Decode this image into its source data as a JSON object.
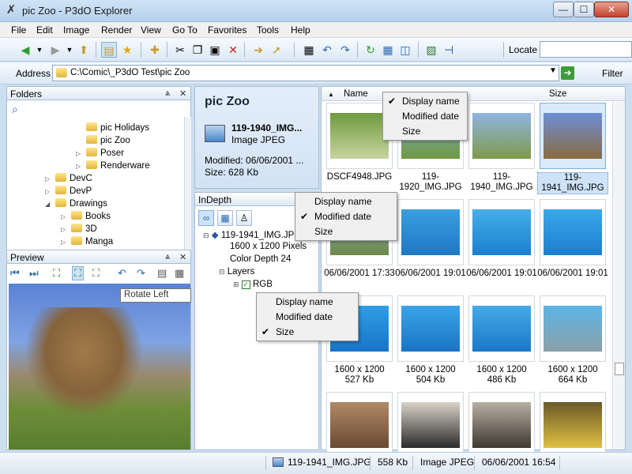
{
  "window": {
    "title": "pic Zoo - P3dO Explorer"
  },
  "menu": [
    "File",
    "Edit",
    "Image",
    "Render",
    "View",
    "Go To",
    "Favorites",
    "Tools",
    "Help"
  ],
  "toolbar": {
    "locate_label": "Locate",
    "locate_value": ""
  },
  "address": {
    "label": "Address",
    "path": "C:\\Comic\\_P3dO Test\\pic Zoo",
    "filter_label": "Filter"
  },
  "folders": {
    "title": "Folders",
    "items": [
      {
        "label": "pic Holidays"
      },
      {
        "label": "pic Zoo"
      },
      {
        "label": "Poser"
      },
      {
        "label": "Renderware"
      },
      {
        "label": "DevC"
      },
      {
        "label": "DevP"
      },
      {
        "label": "Drawings"
      },
      {
        "label": "Books"
      },
      {
        "label": "3D"
      },
      {
        "label": "Manga"
      }
    ]
  },
  "preview": {
    "title": "Preview",
    "tooltip": "Rotate Left"
  },
  "info": {
    "title": "pic Zoo",
    "name": "119-1940_IMG...",
    "type": "Image JPEG",
    "modified": "Modified: 06/06/2001 ...",
    "size": "Size: 628 Kb"
  },
  "indepth": {
    "title": "InDepth",
    "tree": [
      "119-1941_IMG.JPG",
      "1600 x 1200 Pixels",
      "Color Depth 24",
      "Layers",
      "RGB"
    ]
  },
  "filelist": {
    "columns": [
      "Name",
      "Size"
    ],
    "thumbs": [
      {
        "caption": "DSCF4948.JPG",
        "colors": [
          "#6e9a3e",
          "#c8d4a0"
        ]
      },
      {
        "caption": "119-1920_IMG.JPG",
        "colors": [
          "#7aa7da",
          "#6f9a3e"
        ]
      },
      {
        "caption": "119-1940_IMG.JPG",
        "colors": [
          "#8fb4e2",
          "#7e9a4a"
        ]
      },
      {
        "caption": "119-1941_IMG.JPG",
        "colors": [
          "#6c8fd8",
          "#8a6b3f"
        ]
      },
      {
        "caption": "06/06/2001 17:33",
        "colors": [
          "#8aa6c0",
          "#6f8a4a"
        ]
      },
      {
        "caption": "06/06/2001 19:01",
        "colors": [
          "#3a9fe0",
          "#1f78c4"
        ]
      },
      {
        "caption": "06/06/2001 19:01",
        "colors": [
          "#46aee8",
          "#1a7fcf"
        ]
      },
      {
        "caption": "06/06/2001 19:01",
        "colors": [
          "#3aa8ea",
          "#1c7ed0"
        ]
      },
      {
        "caption": "1600 x 1200\n527 Kb",
        "colors": [
          "#2f9ee6",
          "#1874c6"
        ]
      },
      {
        "caption": "1600 x 1200\n504 Kb",
        "colors": [
          "#3aa4e8",
          "#1a74c4"
        ]
      },
      {
        "caption": "1600 x 1200\n486 Kb",
        "colors": [
          "#45aae8",
          "#1b78c8"
        ]
      },
      {
        "caption": "1600 x 1200\n664 Kb",
        "colors": [
          "#5cb4e6",
          "#8aa0a8"
        ]
      },
      {
        "caption": "",
        "colors": [
          "#b08a66",
          "#6a4a34"
        ]
      },
      {
        "caption": "",
        "colors": [
          "#d8d2c8",
          "#2a2a2a"
        ]
      },
      {
        "caption": "",
        "colors": [
          "#b9b0a4",
          "#3e3830"
        ]
      },
      {
        "caption": "",
        "colors": [
          "#6a5a2a",
          "#e0c040"
        ]
      }
    ]
  },
  "context_menus": [
    {
      "items": [
        {
          "label": "Display name",
          "checked": true
        },
        {
          "label": "Modified date",
          "checked": false
        },
        {
          "label": "Size",
          "checked": false
        }
      ]
    },
    {
      "items": [
        {
          "label": "Display name",
          "checked": false
        },
        {
          "label": "Modified date",
          "checked": true
        },
        {
          "label": "Size",
          "checked": false
        }
      ]
    },
    {
      "items": [
        {
          "label": "Display name",
          "checked": false
        },
        {
          "label": "Modified date",
          "checked": false
        },
        {
          "label": "Size",
          "checked": true
        }
      ]
    }
  ],
  "status": {
    "file": "119-1941_IMG.JPG",
    "size": "558 Kb",
    "type": "Image JPEG",
    "date": "06/06/2001 16:54"
  }
}
